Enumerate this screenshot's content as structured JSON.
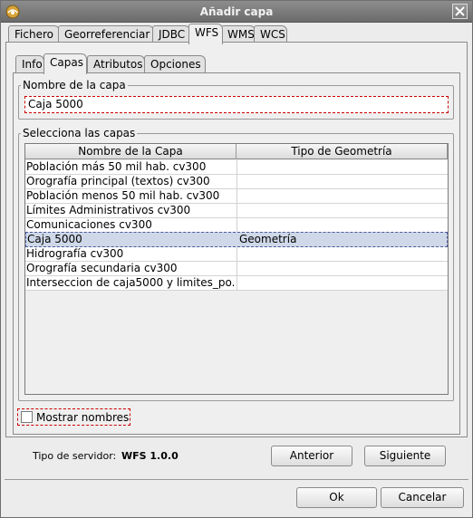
{
  "window": {
    "title": "Añadir capa"
  },
  "tabs": [
    {
      "label": "Fichero",
      "active": false
    },
    {
      "label": "Georreferenciar",
      "active": false
    },
    {
      "label": "JDBC",
      "active": false
    },
    {
      "label": "WFS",
      "active": true
    },
    {
      "label": "WMS",
      "active": false
    },
    {
      "label": "WCS",
      "active": false
    }
  ],
  "subtabs": [
    {
      "label": "Info",
      "active": false
    },
    {
      "label": "Capas",
      "active": true
    },
    {
      "label": "Atributos",
      "active": false
    },
    {
      "label": "Opciones",
      "active": false
    }
  ],
  "layer_name": {
    "legend": "Nombre de la capa",
    "value": "Caja 5000"
  },
  "layers": {
    "legend": "Selecciona las capas",
    "columns": [
      "Nombre de la Capa",
      "Tipo de Geometría"
    ],
    "rows": [
      {
        "name": "Población más 50 mil hab. cv300",
        "type": "",
        "selected": false
      },
      {
        "name": "Orografía principal (textos) cv300",
        "type": "",
        "selected": false
      },
      {
        "name": "Población menos 50 mil hab. cv300",
        "type": "",
        "selected": false
      },
      {
        "name": "Límites Administrativos cv300",
        "type": "",
        "selected": false
      },
      {
        "name": "Comunicaciones cv300",
        "type": "",
        "selected": false
      },
      {
        "name": "Caja 5000",
        "type": "Geometría",
        "selected": true
      },
      {
        "name": "Hidrografía cv300",
        "type": "",
        "selected": false
      },
      {
        "name": "Orografía secundaria cv300",
        "type": "",
        "selected": false
      },
      {
        "name": "Interseccion de caja5000 y limites_po...",
        "type": "",
        "selected": false
      }
    ]
  },
  "show_names": {
    "label": "Mostrar nombres",
    "checked": false
  },
  "server": {
    "label": "Tipo de servidor:",
    "value": "WFS 1.0.0"
  },
  "buttons": {
    "previous": "Anterior",
    "next": "Siguiente",
    "ok": "Ok",
    "cancel": "Cancelar"
  },
  "icons": {
    "app": "app-icon",
    "close": "close-icon"
  }
}
